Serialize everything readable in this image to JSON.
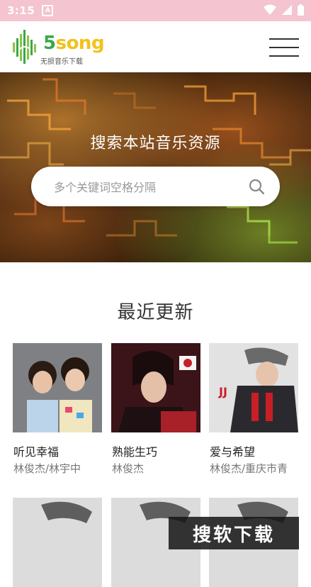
{
  "status_bar": {
    "time": "3:15"
  },
  "header": {
    "logo_number": "5",
    "logo_word": "song",
    "logo_tagline": "无损音乐下载"
  },
  "hero": {
    "title": "搜索本站音乐资源",
    "search_placeholder": "多个关键词空格分隔"
  },
  "section": {
    "title": "最近更新"
  },
  "songs": [
    {
      "name": "听见幸福",
      "artist": "林俊杰/林宇中"
    },
    {
      "name": "熟能生巧",
      "artist": "林俊杰"
    },
    {
      "name": "爱与希望",
      "artist": "林俊杰/重庆市青"
    }
  ],
  "watermark": "搜软下载",
  "colors": {
    "status_bar": "#f4c4d0",
    "logo_green": "#3aa84a",
    "logo_yellow": "#f2c21a"
  }
}
